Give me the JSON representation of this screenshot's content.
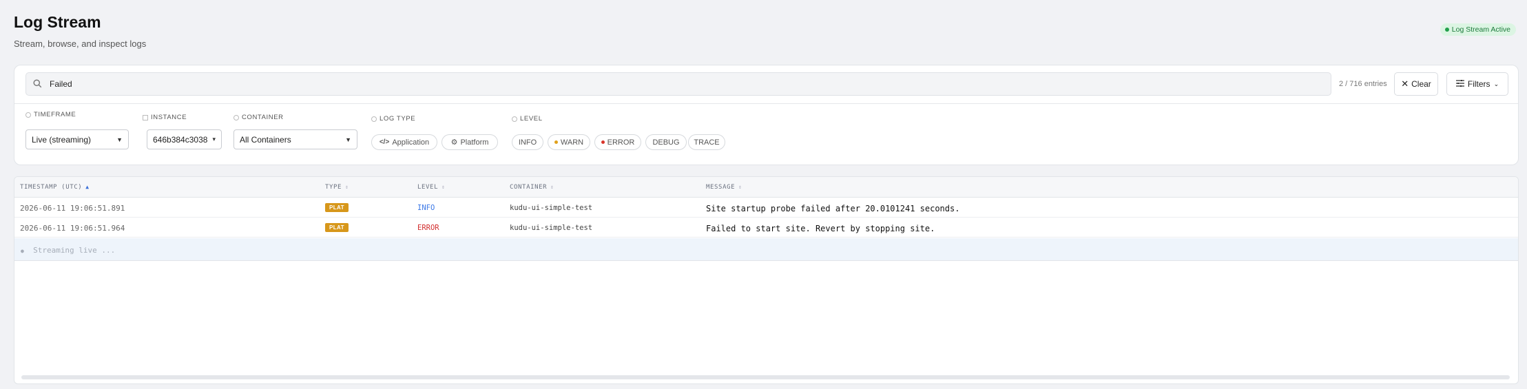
{
  "header": {
    "title": "Log Stream",
    "subtitle": "Stream, browse, and inspect logs",
    "status_badge": "Log Stream Active"
  },
  "search": {
    "value": "Failed",
    "entry_count": "2 / 716 entries",
    "clear_label": "Clear",
    "filters_label": "Filters"
  },
  "filters": {
    "timeframe": {
      "label": "TIMEFRAME",
      "selected": "Live (streaming)"
    },
    "instance": {
      "label": "INSTANCE",
      "selected": "646b384c3038"
    },
    "container": {
      "label": "CONTAINER",
      "selected": "All Containers"
    },
    "log_type": {
      "label": "LOG TYPE",
      "options": [
        "Application",
        "Platform"
      ]
    },
    "level": {
      "label": "LEVEL",
      "options": [
        "INFO",
        "WARN",
        "ERROR",
        "DEBUG",
        "TRACE"
      ]
    }
  },
  "table": {
    "columns": [
      "TIMESTAMP (UTC)",
      "TYPE",
      "LEVEL",
      "CONTAINER",
      "MESSAGE"
    ],
    "rows": [
      {
        "timestamp": "2026-06-11 19:06:51.891",
        "type": "PLAT",
        "level": "INFO",
        "container": "kudu-ui-simple-test",
        "message": "Site startup probe failed after 20.0101241 seconds."
      },
      {
        "timestamp": "2026-06-11 19:06:51.964",
        "type": "PLAT",
        "level": "ERROR",
        "container": "kudu-ui-simple-test",
        "message": "Failed to start site. Revert by stopping site."
      }
    ],
    "streaming_text": "Streaming live ..."
  },
  "colors": {
    "accent": "#3b6fd8",
    "plat_badge": "#d7971b",
    "info": "#3b78e7",
    "error": "#d22e2e",
    "warn": "#e0a11b",
    "active": "#22a04b"
  }
}
